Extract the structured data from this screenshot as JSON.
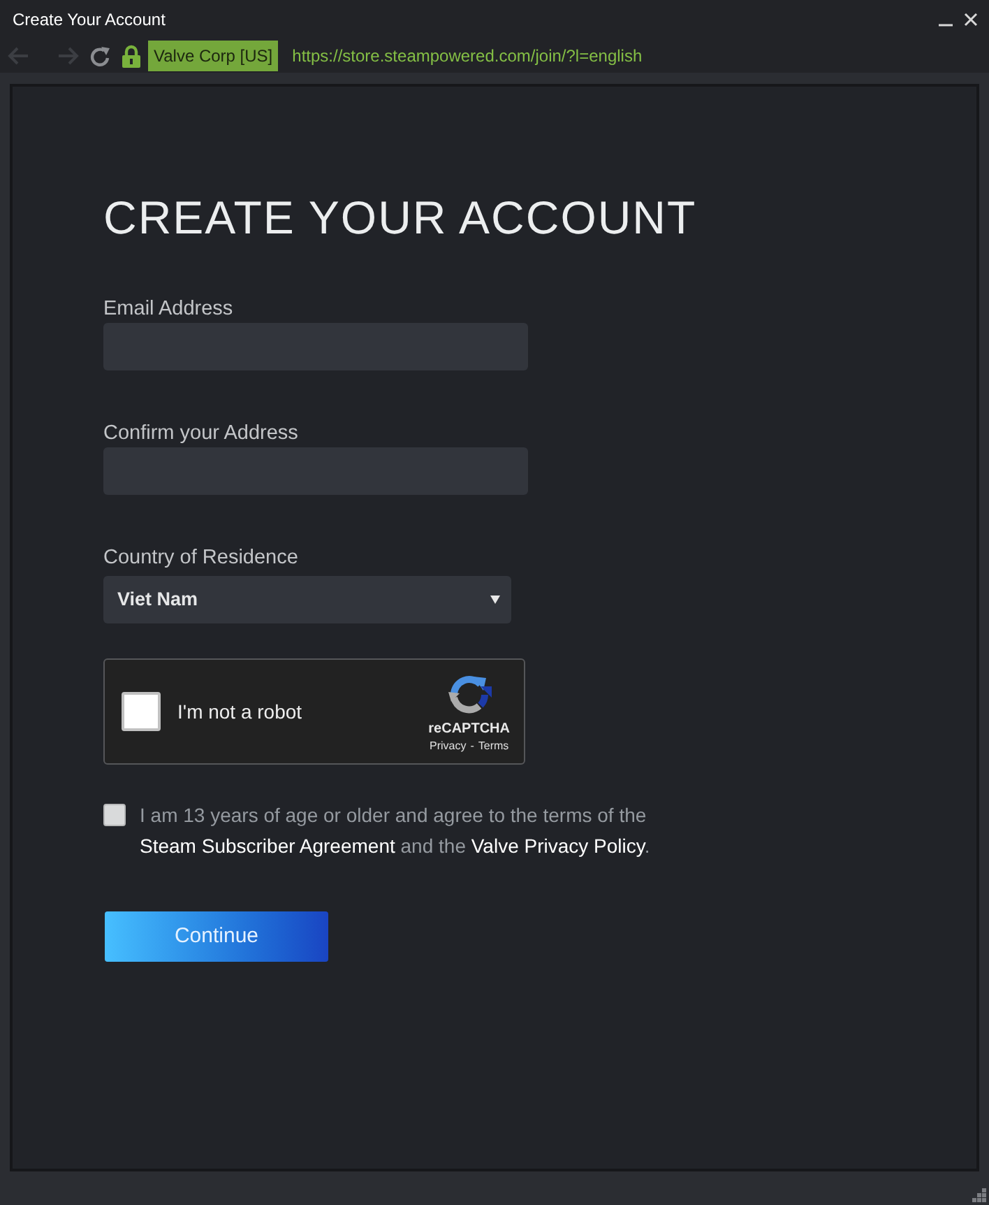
{
  "window": {
    "title": "Create Your Account"
  },
  "browser": {
    "back": {
      "disabled": true
    },
    "forward": {
      "disabled": true
    },
    "certificate": "Valve Corp [US]",
    "url": "https://store.steampowered.com/join/?l=english"
  },
  "form": {
    "heading": "CREATE YOUR ACCOUNT",
    "fields": [
      {
        "kind": "text",
        "label": "Email Address"
      },
      {
        "kind": "text",
        "label": "Confirm your Address"
      },
      {
        "kind": "select",
        "label": "Country of Residence",
        "value": "Viet Nam"
      }
    ],
    "captcha": {
      "checked": false,
      "label": "I'm not a robot",
      "brand": "reCAPTCHA",
      "links": [
        "Privacy",
        "Terms"
      ],
      "separator": "-"
    },
    "agreement": {
      "checked": false,
      "parts": [
        {
          "kind": "text",
          "text": "I am 13 years of age or older and agree to the terms of the "
        },
        {
          "kind": "link",
          "text": "Steam Subscriber Agreement"
        },
        {
          "kind": "text",
          "text": " and the "
        },
        {
          "kind": "link",
          "text": "Valve Privacy Policy"
        },
        {
          "kind": "text",
          "text": "."
        }
      ]
    },
    "submit": {
      "label": "Continue"
    }
  }
}
